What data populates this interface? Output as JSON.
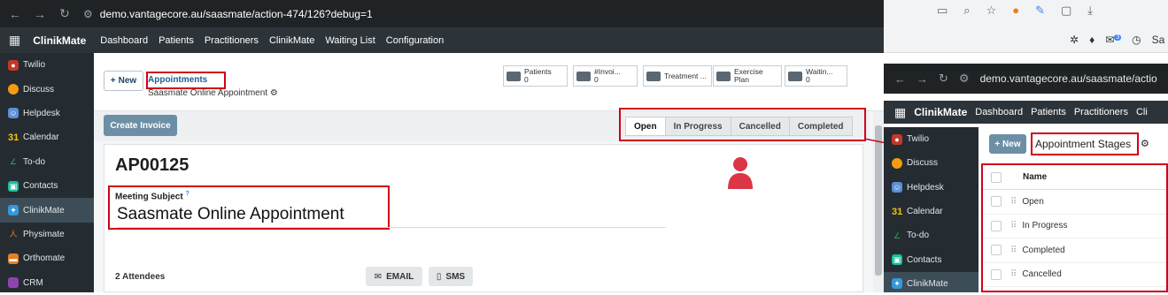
{
  "browser": {
    "url": "demo.vantagecore.au/saasmate/action-474/126?debug=1"
  },
  "extensions": {
    "icons": [
      "screen-share-icon",
      "zoom-icon",
      "star-icon",
      "extension-icon",
      "pen-icon",
      "puzzle-icon",
      "download-icon"
    ],
    "chat_badge": "3",
    "user_initial": "Sa"
  },
  "appbar": {
    "brand": "ClinikMate",
    "menus": [
      "Dashboard",
      "Patients",
      "Practitioners",
      "ClinikMate",
      "Waiting List",
      "Configuration"
    ]
  },
  "sidebar": {
    "items": [
      {
        "label": "Twilio",
        "color": "#c0392b",
        "icon": "twilio-icon"
      },
      {
        "label": "Discuss",
        "color": "#f39c12",
        "icon": "discuss-icon"
      },
      {
        "label": "Helpdesk",
        "color": "#5b8fd6",
        "icon": "helpdesk-icon"
      },
      {
        "label": "Calendar",
        "color": "#f1c40f",
        "icon": "calendar-icon"
      },
      {
        "label": "To-do",
        "color": "#27ae60",
        "icon": "todo-icon"
      },
      {
        "label": "Contacts",
        "color": "#1abc9c",
        "icon": "contacts-icon"
      },
      {
        "label": "ClinikMate",
        "color": "#3498db",
        "icon": "clinikmate-icon"
      },
      {
        "label": "Physimate",
        "color": "#e67e22",
        "icon": "physimate-icon"
      },
      {
        "label": "Orthomate",
        "color": "#e67e22",
        "icon": "orthomate-icon"
      },
      {
        "label": "CRM",
        "color": "#8e44ad",
        "icon": "crm-icon"
      }
    ]
  },
  "control": {
    "new_label": "New",
    "breadcrumb": "Appointments",
    "record_name": "Saasmate Online Appointment"
  },
  "stat_buttons": [
    {
      "label": "Patients",
      "count": "0"
    },
    {
      "label": "#Invoi...",
      "count": "0"
    },
    {
      "label": "Treatment ...",
      "count": ""
    },
    {
      "label": "Exercise Plan",
      "count": ""
    },
    {
      "label": "Waitin...",
      "count": "0"
    }
  ],
  "action": {
    "create_invoice": "Create Invoice"
  },
  "stages": [
    "Open",
    "In Progress",
    "Cancelled",
    "Completed"
  ],
  "current_stage": "Open",
  "form": {
    "ref": "AP00125",
    "subject_label": "Meeting Subject",
    "subject_help": "?",
    "subject_value": "Saasmate Online Appointment",
    "attendees": "2 Attendees",
    "email_label": "EMAIL",
    "sms_label": "SMS"
  },
  "overlay": {
    "url": "demo.vantagecore.au/saasmate/actio",
    "brand": "ClinikMate",
    "menus": [
      "Dashboard",
      "Patients",
      "Practitioners",
      "Cli"
    ],
    "sidebar": [
      "Twilio",
      "Discuss",
      "Helpdesk",
      "Calendar",
      "To-do",
      "Contacts",
      "ClinikMate"
    ],
    "new_label": "New",
    "title": "Appointment Stages",
    "column": "Name",
    "rows": [
      "Open",
      "In Progress",
      "Completed",
      "Cancelled"
    ]
  },
  "colors": {
    "highlight": "#d0021b",
    "accent": "#6c8fa6",
    "topbar": "#2d3439",
    "sidebar": "#252c31"
  }
}
